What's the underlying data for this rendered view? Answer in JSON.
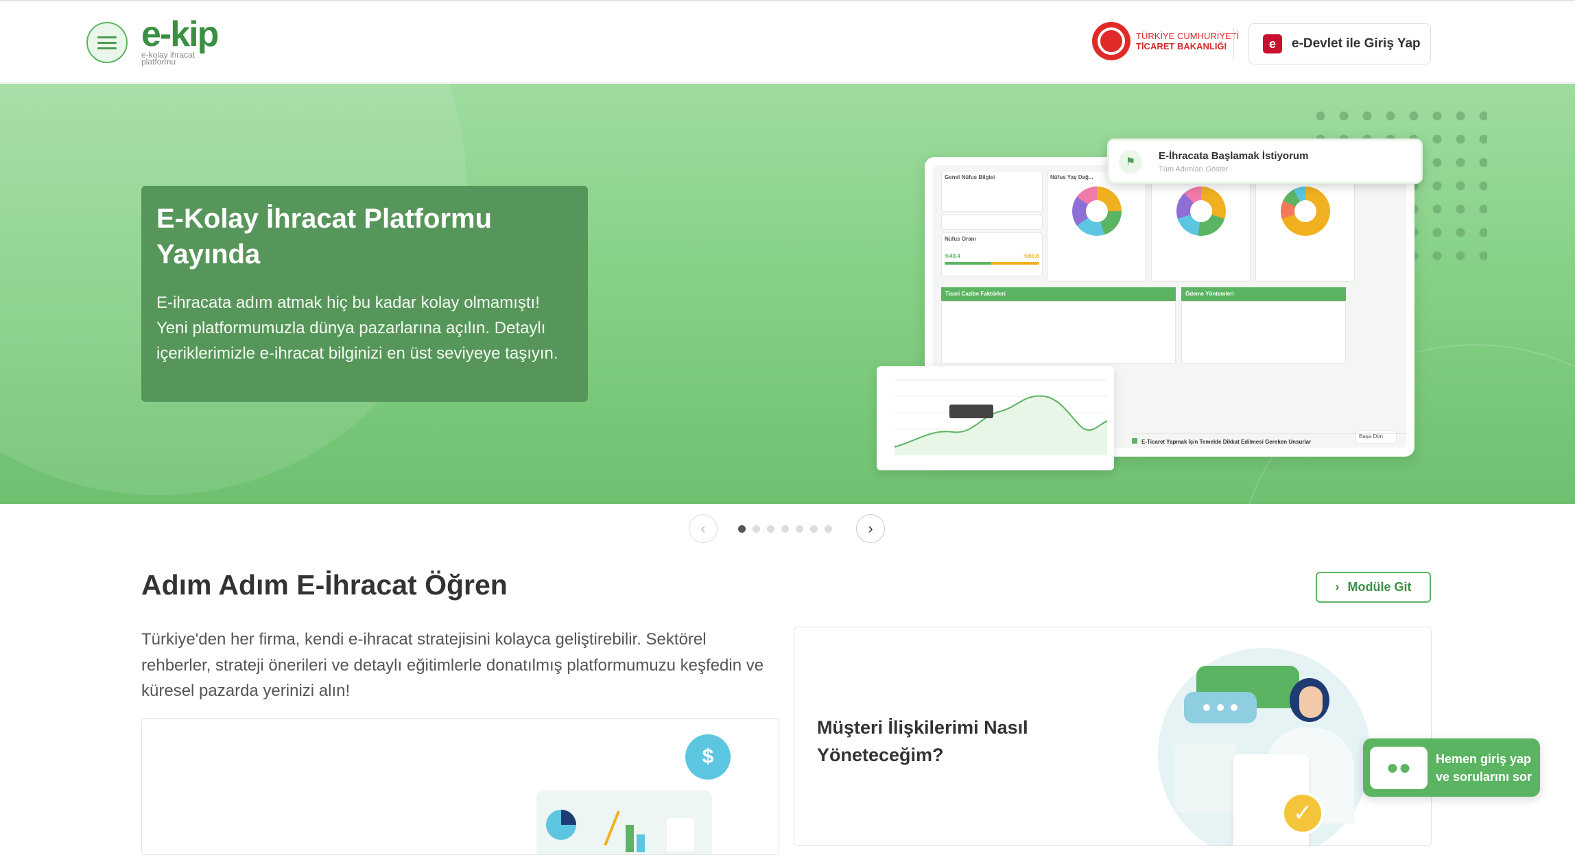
{
  "header": {
    "logo_text": "e-kip",
    "logo_tagline_1": "e-kolay ihracat",
    "logo_tagline_2": "platformu",
    "ministry_line_1": "TÜRKİYE CUMHURİYETİ",
    "ministry_line_2": "TİCARET BAKANLIĞI",
    "login_label": "e-Devlet ile Giriş Yap"
  },
  "hero": {
    "title": "E-Kolay İhracat Platformu Yayında",
    "description": "E-ihracata adım atmak hiç bu kadar kolay olmamıştı! Yeni platformumuzla dünya pazarlarına açılın. Detaylı içeriklerimizle e-ihracat bilginizi en üst seviyeye taşıyın.",
    "mock": {
      "pill_title": "E-İhracata Başlamak İstiyorum",
      "pill_subtitle": "Tüm Adımları Göster",
      "box_general": "Genel Nüfus Bilgisi",
      "box_age": "Nüfus Yaş Dağ...",
      "box_ratio": "Nüfus Oranı",
      "ratio_male": "%49.4",
      "ratio_female": "%50.6",
      "bar_trade": "Ticari Cazibe Faktörleri",
      "bar_payment": "Ödeme Yöntemleri",
      "footer_text": "E-Ticaret Yapmak İçin Temelde Dikkat Edilmesi Gereken Unsurlar",
      "back_label": "Başa Dön"
    },
    "slide_count": 7,
    "active_slide": 1
  },
  "learn": {
    "title": "Adım Adım E-İhracat Öğren",
    "module_button": "Modüle Git",
    "description": "Türkiye'den her firma, kendi e-ihracat stratejisini kolayca geliştirebilir. Sektörel rehberler, strateji önerileri ve detaylı eğitimlerle donatılmış platformumuzu keşfedin ve küresel pazarda yerinizi alın!",
    "card_right_title": "Müşteri İlişkilerimi Nasıl Yöneteceğim?"
  },
  "chatbot": {
    "line_1": "Hemen giriş yap",
    "line_2": "ve sorularını sor"
  },
  "colors": {
    "brand_green": "#5bb462",
    "hero_card": "#57965a",
    "edevlet_red": "#c8102e"
  }
}
